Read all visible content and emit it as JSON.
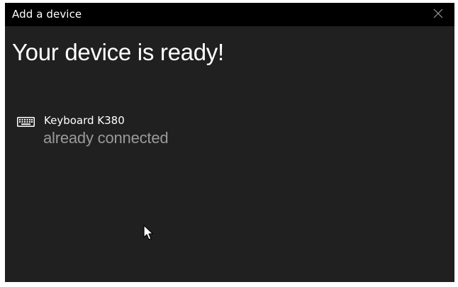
{
  "window": {
    "title": "Add a device",
    "close_icon": "close-icon"
  },
  "main": {
    "heading": "Your device is ready!",
    "devices": [
      {
        "icon": "keyboard-icon",
        "name": "Keyboard K380",
        "status": "already connected"
      }
    ]
  },
  "colors": {
    "titlebar_bg": "#000000",
    "window_bg": "#202020",
    "text_primary": "#ffffff",
    "text_secondary": "#9a9a9a"
  }
}
